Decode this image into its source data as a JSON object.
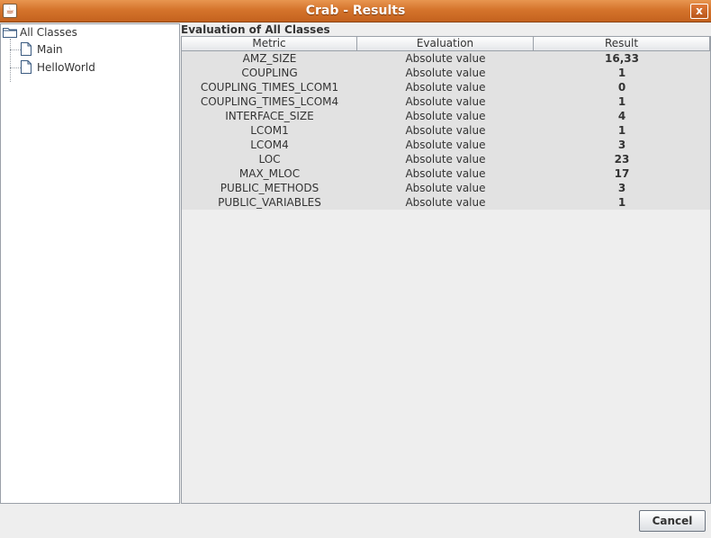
{
  "window": {
    "title": "Crab - Results",
    "icon": "java-cup-icon",
    "close_label": "x"
  },
  "tree": {
    "root": {
      "label": "All Classes",
      "icon": "folder-icon"
    },
    "children": [
      {
        "label": "Main",
        "icon": "file-icon"
      },
      {
        "label": "HelloWorld",
        "icon": "file-icon"
      }
    ]
  },
  "results": {
    "title": "Evaluation of All Classes",
    "columns": [
      "Metric",
      "Evaluation",
      "Result"
    ],
    "rows": [
      {
        "metric": "AMZ_SIZE",
        "evaluation": "Absolute value",
        "result": "16,33"
      },
      {
        "metric": "COUPLING",
        "evaluation": "Absolute value",
        "result": "1"
      },
      {
        "metric": "COUPLING_TIMES_LCOM1",
        "evaluation": "Absolute value",
        "result": "0"
      },
      {
        "metric": "COUPLING_TIMES_LCOM4",
        "evaluation": "Absolute value",
        "result": "1"
      },
      {
        "metric": "INTERFACE_SIZE",
        "evaluation": "Absolute value",
        "result": "4"
      },
      {
        "metric": "LCOM1",
        "evaluation": "Absolute value",
        "result": "1"
      },
      {
        "metric": "LCOM4",
        "evaluation": "Absolute value",
        "result": "3"
      },
      {
        "metric": "LOC",
        "evaluation": "Absolute value",
        "result": "23"
      },
      {
        "metric": "MAX_MLOC",
        "evaluation": "Absolute value",
        "result": "17"
      },
      {
        "metric": "PUBLIC_METHODS",
        "evaluation": "Absolute value",
        "result": "3"
      },
      {
        "metric": "PUBLIC_VARIABLES",
        "evaluation": "Absolute value",
        "result": "1"
      }
    ]
  },
  "footer": {
    "cancel_label": "Cancel"
  },
  "colors": {
    "titlebar": "#d5742c",
    "panel_bg": "#eeeeee",
    "rows_bg": "#e2e2e2"
  }
}
